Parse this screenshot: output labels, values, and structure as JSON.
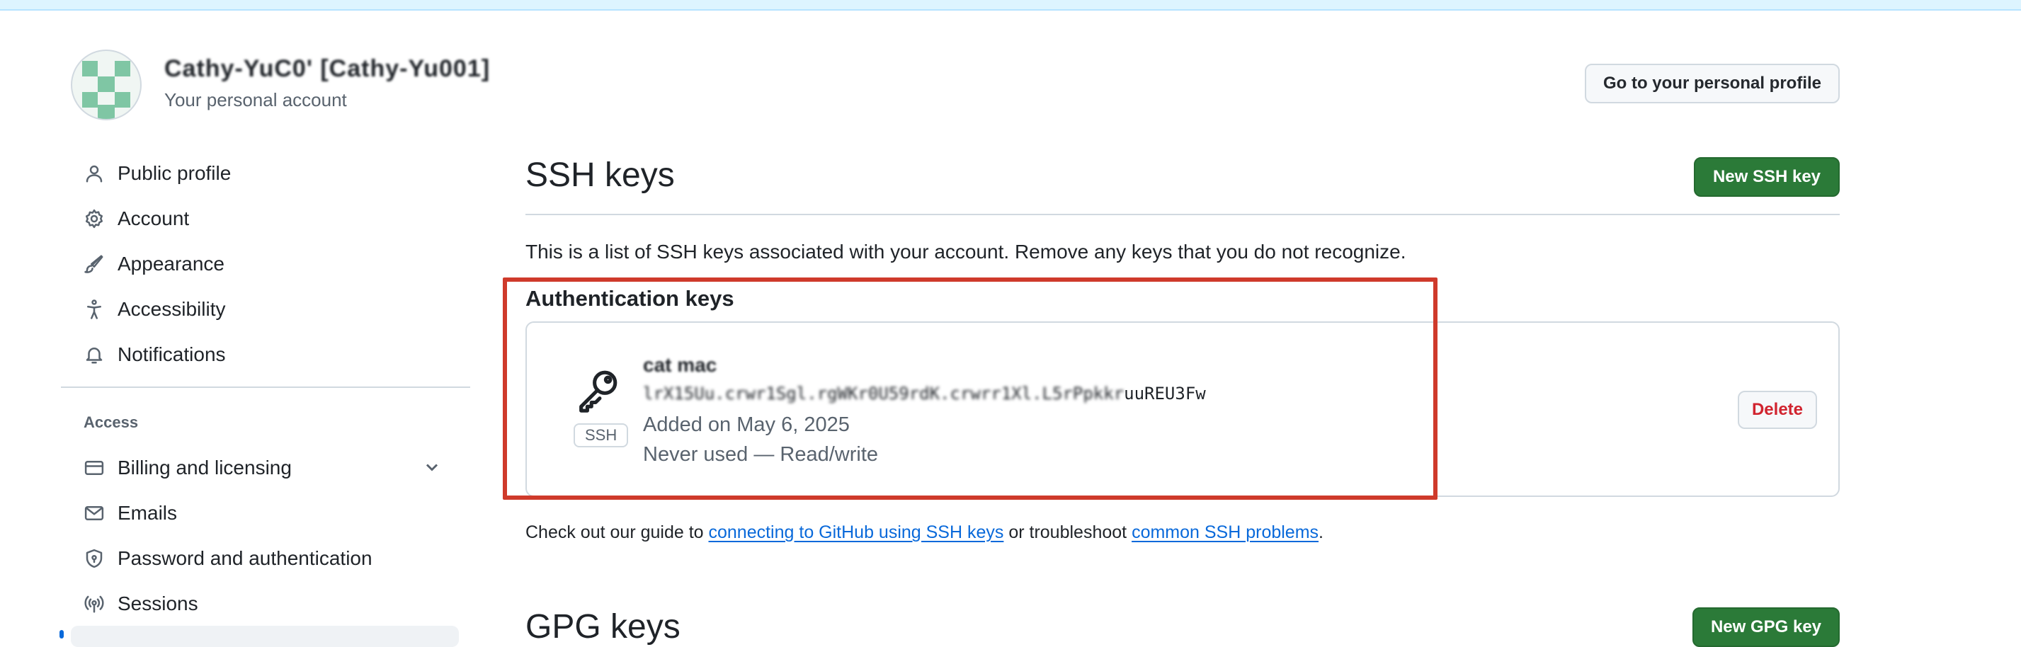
{
  "header": {
    "account_name": "Cathy-YuC0' [Cathy-Yu001]",
    "account_subtitle": "Your personal account",
    "profile_button": "Go to your personal profile"
  },
  "sidebar": {
    "items": [
      {
        "label": "Public profile",
        "icon": "person-icon"
      },
      {
        "label": "Account",
        "icon": "gear-icon"
      },
      {
        "label": "Appearance",
        "icon": "paintbrush-icon"
      },
      {
        "label": "Accessibility",
        "icon": "accessibility-icon"
      },
      {
        "label": "Notifications",
        "icon": "bell-icon"
      }
    ],
    "access_label": "Access",
    "access_items": [
      {
        "label": "Billing and licensing",
        "icon": "credit-card-icon"
      },
      {
        "label": "Emails",
        "icon": "mail-icon"
      },
      {
        "label": "Password and authentication",
        "icon": "shield-lock-icon"
      },
      {
        "label": "Sessions",
        "icon": "broadcast-icon"
      }
    ]
  },
  "main": {
    "ssh_title": "SSH keys",
    "new_ssh_button": "New SSH key",
    "intro": "This is a list of SSH keys associated with your account. Remove any keys that you do not recognize.",
    "auth_heading": "Authentication keys",
    "key": {
      "title": "cat mac",
      "badge": "SSH",
      "fingerprint_hidden": "lrX15Uu.crwr1Sgl.rgWKr0U59rdK.crwrr1Xl.L5rPpkkr",
      "fingerprint_visible": "uuREU3Fw",
      "added": "Added on May 6, 2025",
      "usage": "Never used — Read/write",
      "delete_button": "Delete"
    },
    "guide": {
      "prefix": "Check out our guide to ",
      "link1": "connecting to GitHub using SSH keys",
      "middle": " or troubleshoot ",
      "link2": "common SSH problems",
      "suffix": "."
    },
    "gpg_title": "GPG keys",
    "new_gpg_button": "New GPG key"
  },
  "colors": {
    "primary_button": "#2b7a38",
    "danger_text": "#d1242f",
    "link": "#0969da",
    "highlight": "#cf3a2b"
  }
}
